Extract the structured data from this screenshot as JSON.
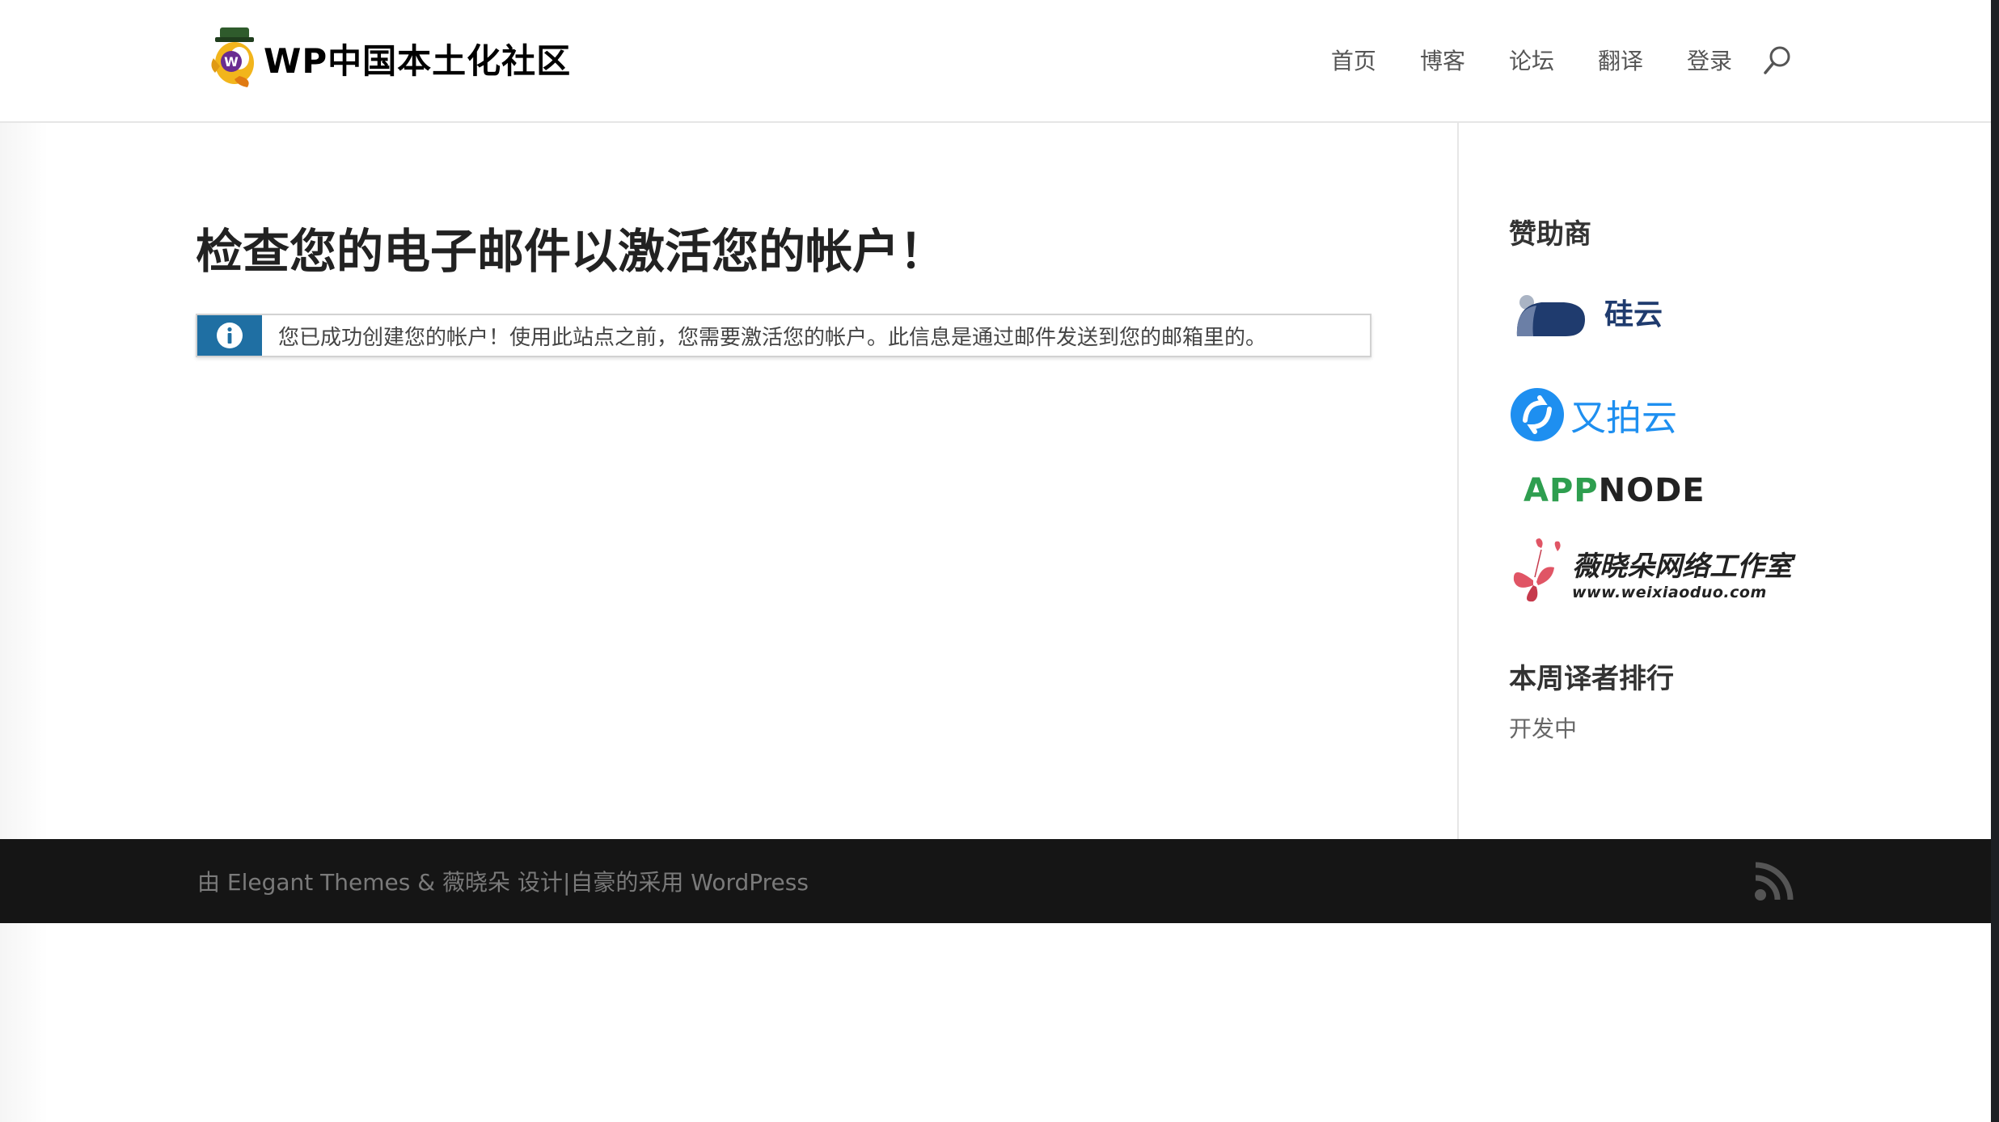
{
  "site": {
    "logo_text": "WP中国本土化社区"
  },
  "nav": {
    "items": [
      {
        "label": "首页"
      },
      {
        "label": "博客"
      },
      {
        "label": "论坛"
      },
      {
        "label": "翻译"
      },
      {
        "label": "登录"
      }
    ]
  },
  "main": {
    "title": "检查您的电子邮件以激活您的帐户！",
    "notice": "您已成功创建您的帐户！使用此站点之前，您需要激活您的帐户。此信息是通过邮件发送到您的邮箱里的。"
  },
  "sidebar": {
    "sponsors_title": "赞助商",
    "sponsors": [
      {
        "name": "硅云",
        "color": "#1f3b6e"
      },
      {
        "name": "又拍云",
        "color": "#1e8ff0"
      },
      {
        "name": "APPNODE",
        "color": "#2e9e4f"
      },
      {
        "name": "薇晓朵网络工作室",
        "subtitle": "www.weixiaoduo.com",
        "color": "#222222",
        "accent": "#e05565"
      }
    ],
    "ranking_title": "本周译者排行",
    "ranking_text": "开发中"
  },
  "footer": {
    "prefix": "由",
    "themes_link": "Elegant Themes",
    "amp": "&",
    "designer_link": "薇晓朵",
    "design": "设计",
    "sep": "|",
    "proudly": "自豪的采用",
    "wp_link": "WordPress"
  },
  "colors": {
    "accent": "#1f6fa3",
    "footer_bg": "#151515"
  }
}
